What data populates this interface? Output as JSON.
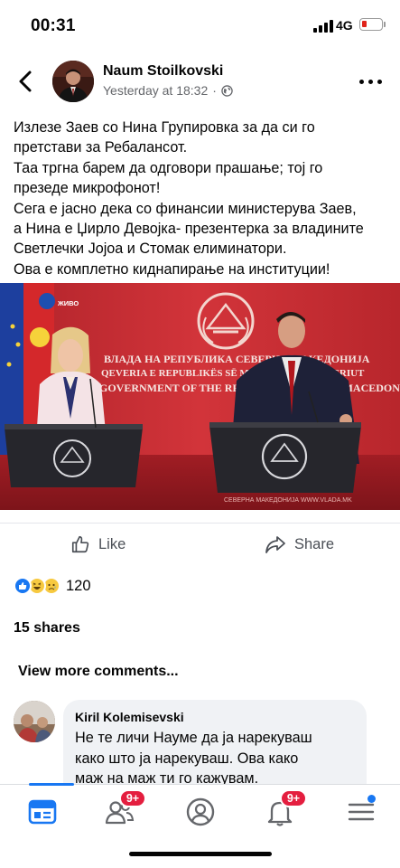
{
  "status_bar": {
    "time": "00:31",
    "network": "4G"
  },
  "post": {
    "author": "Naum Stoilkovski",
    "timestamp": "Yesterday at 18:32",
    "separator": "·",
    "privacy_icon": "globe-icon",
    "text_lines": [
      "Излезе Заев со Нина Групировка за да си го",
      "претстави за Ребалансот.",
      "Таа тргна барем да одговори прашање; тој го",
      "презеде микрофонот!",
      "Сега е јасно дека со финансии министерува Заев,",
      "а Нина е Џирло Девојка- презентерка за владините",
      "Светлечки Јојоа и Стомак елиминатори.",
      "Ова е комплетно киднапирање на институции!"
    ],
    "photo": {
      "banner_lines": [
        "ВЛАДА НА РЕПУБЛИКА СЕВЕРНА МАКЕДОНИЈА",
        "QEVERIA E REPUBLIKËS SË MAQEDONISË SË VERIUT",
        "GOVERNMENT OF THE REPUBLIC OF NORTH MACEDONIA"
      ],
      "live_label": "ЖИВО",
      "footer_text": "СЕВЕРНА МАКЕДОНИЈА   WWW.VLADA.MK"
    }
  },
  "actions": {
    "like_label": "Like",
    "share_label": "Share"
  },
  "reactions": {
    "count": "120",
    "types": [
      "like",
      "haha",
      "sad"
    ]
  },
  "shares_label": "15 shares",
  "view_more_label": "View more comments...",
  "comment": {
    "author": "Kiril Kolemisevski",
    "lines": [
      "Не те личи Науме да ја нарекуваш",
      "како што ја нарекуваш. Ова како",
      "маж на маж ти го кажувам."
    ]
  },
  "bottom_nav": {
    "items": [
      {
        "icon": "news-feed-icon",
        "badge": ""
      },
      {
        "icon": "friends-icon",
        "badge": "9+"
      },
      {
        "icon": "profile-icon",
        "badge": ""
      },
      {
        "icon": "notifications-icon",
        "badge": "9+"
      },
      {
        "icon": "menu-icon",
        "badge": ""
      }
    ]
  },
  "colors": {
    "accent": "#1877f2",
    "badge": "#e41e3f",
    "photo_backdrop": "#c62a2f"
  }
}
